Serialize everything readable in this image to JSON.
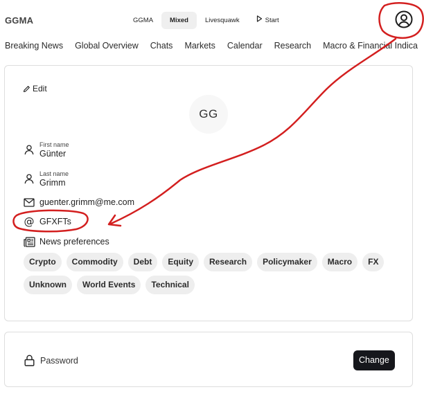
{
  "app": {
    "title": "GGMA"
  },
  "modes": [
    {
      "label": "GGMA"
    },
    {
      "label": "Mixed"
    },
    {
      "label": "Livesquawk"
    },
    {
      "label": "Start"
    }
  ],
  "nav": [
    {
      "label": "Breaking News"
    },
    {
      "label": "Global Overview"
    },
    {
      "label": "Chats"
    },
    {
      "label": "Markets"
    },
    {
      "label": "Calendar"
    },
    {
      "label": "Research"
    },
    {
      "label": "Macro & Financial Indica"
    }
  ],
  "profile": {
    "edit_label": "Edit",
    "initials": "GG",
    "first_name_label": "First name",
    "first_name": "Günter",
    "last_name_label": "Last name",
    "last_name": "Grimm",
    "email": "guenter.grimm@me.com",
    "handle": "GFXFTs",
    "news_pref_label": "News preferences",
    "tags_row1": [
      "Crypto",
      "Commodity",
      "Debt",
      "Equity",
      "Research",
      "Policymaker",
      "Macro",
      "FX"
    ],
    "tags_row2": [
      "Unknown",
      "World Events",
      "Technical"
    ]
  },
  "security": {
    "password_label": "Password",
    "change_label": "Change"
  },
  "colors": {
    "annotation": "#d31f1f",
    "button": "#16171c"
  }
}
